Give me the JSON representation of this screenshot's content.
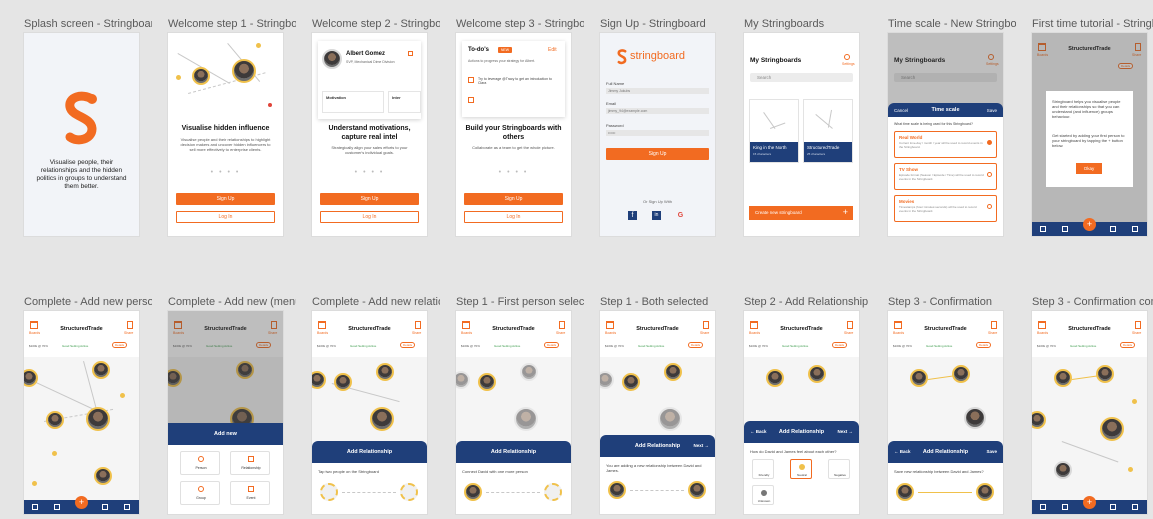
{
  "frames": [
    {
      "id": "splash",
      "label": "Splash screen - Stringboard",
      "text": "Visualise people, their relationships and the hidden politics in groups to understand them better."
    },
    {
      "id": "welcome1",
      "label": "Welcome step 1 - Stringboard",
      "title": "Visualise hidden influence",
      "body": "Visualise people and their relationships to highlight decision makers and uncover hidden influencers to sell more effectively to enterprise clients.",
      "primary": "Sign Up",
      "secondary": "Log In"
    },
    {
      "id": "welcome2",
      "label": "Welcome step 2 - Stringboard",
      "person_name": "Albert Gomez",
      "person_role": "SVP, Mechanical Dime Division",
      "tab_motivation": "Motivation",
      "tab_interests": "Inter",
      "title": "Understand motivations, capture real intel",
      "body": "Strategically align your sales efforts to your customer's individual goals.",
      "primary": "Sign Up",
      "secondary": "Log In"
    },
    {
      "id": "welcome3",
      "label": "Welcome step 3 - Stringboard",
      "todo_title": "To-do's",
      "todo_badge": "NEW",
      "todo_edit": "Edit",
      "todo_desc": "Actions to progress your strategy for Albert.",
      "todo_item1": "Try to leverage @Tracy to get an introduction to Clara",
      "title": "Build your Stringboards with others",
      "body": "Collaborate as a team to get the whole picture.",
      "primary": "Sign Up",
      "secondary": "Log In"
    },
    {
      "id": "signup",
      "label": "Sign Up - Stringboard",
      "logo": "stringboard",
      "full_name_label": "Full Name",
      "full_name_value": "Jimmy Jukubs",
      "email_label": "Email",
      "email_value": "jimmy_94@example.com",
      "password_label": "Password",
      "password_value": "••••••",
      "button": "Sign Up",
      "or_text": "Or Sign Up With",
      "social": [
        "f",
        "in",
        "G"
      ]
    },
    {
      "id": "my-boards",
      "label": "My Stringboards",
      "title": "My Stringboards",
      "settings": "Settings",
      "search_placeholder": "Search",
      "boards": [
        {
          "name": "King in the North",
          "meta": "15 characters"
        },
        {
          "name": "StructuredTrade",
          "meta": "25 characters"
        }
      ],
      "create": "Create new stringboard"
    },
    {
      "id": "time-scale",
      "label": "Time scale - New Stringboard",
      "title": "My Stringboards",
      "settings": "Settings",
      "search_placeholder": "Search",
      "cancel": "Cancel",
      "heading": "Time scale",
      "save": "Save",
      "question": "What time scale is being used for this Stringboard?",
      "options": [
        {
          "title": "Real World",
          "desc": "Current time-day / month / year will be used to record events in the Stringboard.",
          "selected": true
        },
        {
          "title": "TV Show",
          "desc": "Episode format (Season / Episode / Time) will be used to record events in the Stringboard.",
          "selected": false
        },
        {
          "title": "Movies",
          "desc": "Timestamps (hour:minutes:seconds) will be used to record events in the Stringboard.",
          "selected": false
        }
      ]
    },
    {
      "id": "tutorial",
      "label": "First time tutorial - Stringboard",
      "board": "StructuredTrade",
      "home": "Boards",
      "share": "Share",
      "details": "Details",
      "intro": "Stringboard helps you visualise people and their relationships so that you can understand (and influence) groups behaviour.",
      "instruction": "Get started by adding your first person to your stringboard by tapping the + button below.",
      "okay": "Okay"
    },
    {
      "id": "complete1",
      "label": "Complete - Add new person",
      "board": "StructuredTrade",
      "home": "Boards",
      "share": "Share",
      "stat1": "$100k @ 70%",
      "stat2": "Good Setting Active",
      "details": "Details"
    },
    {
      "id": "complete2",
      "label": "Complete - Add new (menu)",
      "board": "StructuredTrade",
      "home": "Boards",
      "share": "Share",
      "stat1": "$100k @ 70%",
      "stat2": "Good Setting Active",
      "details": "Details",
      "sheet_title": "Add new",
      "options": [
        "Person",
        "Relationship",
        "Group",
        "Event"
      ]
    },
    {
      "id": "complete3",
      "label": "Complete - Add new relationship",
      "board": "StructuredTrade",
      "home": "Boards",
      "share": "Share",
      "stat1": "$100k @ 70%",
      "stat2": "Good Setting Active",
      "details": "Details",
      "sheet_title": "Add Relationship",
      "hint": "Tap two people on the Stringboard"
    },
    {
      "id": "step1a",
      "label": "Step 1 - First person selected",
      "board": "StructuredTrade",
      "home": "Boards",
      "share": "Share",
      "stat1": "$100k @ 70%",
      "stat2": "Good Setting Active",
      "details": "Details",
      "sheet_title": "Add Relationship",
      "hint": "Connect David with one more person"
    },
    {
      "id": "step1b",
      "label": "Step 1 - Both selected",
      "board": "StructuredTrade",
      "home": "Boards",
      "share": "Share",
      "stat1": "$100k @ 70%",
      "stat2": "Good Setting Active",
      "details": "Details",
      "sheet_title": "Add Relationship",
      "next": "Next →",
      "hint": "You are adding a new relationship between David and James."
    },
    {
      "id": "step2",
      "label": "Step 2 - Add Relationship",
      "board": "StructuredTrade",
      "home": "Boards",
      "share": "Share",
      "stat1": "$100k @ 70%",
      "stat2": "Good Setting Active",
      "details": "Details",
      "back": "← Back",
      "sheet_title": "Add Relationship",
      "next": "Next →",
      "question": "How do David and James feel about each other?",
      "choices": [
        "Friendly",
        "Neutral",
        "Negative",
        "Unknown"
      ]
    },
    {
      "id": "step3a",
      "label": "Step 3 - Confirmation",
      "board": "StructuredTrade",
      "home": "Boards",
      "share": "Share",
      "stat1": "$100k @ 70%",
      "stat2": "Good Setting Active",
      "details": "Details",
      "back": "← Back",
      "sheet_title": "Add Relationship",
      "save": "Save",
      "hint": "Save new relationship between David and James?"
    },
    {
      "id": "step3b",
      "label": "Step 3 - Confirmation complete",
      "board": "StructuredTrade",
      "home": "Boards",
      "share": "Share",
      "stat1": "$100k @ 70%",
      "stat2": "Good Setting Active",
      "details": "Details"
    }
  ],
  "colors": {
    "accent": "#f26b21",
    "navy": "#1f3f7a",
    "canvas": "#e5e5e5"
  },
  "nav_items": [
    "Stringboard",
    "Timeline",
    "People",
    "Groups"
  ]
}
